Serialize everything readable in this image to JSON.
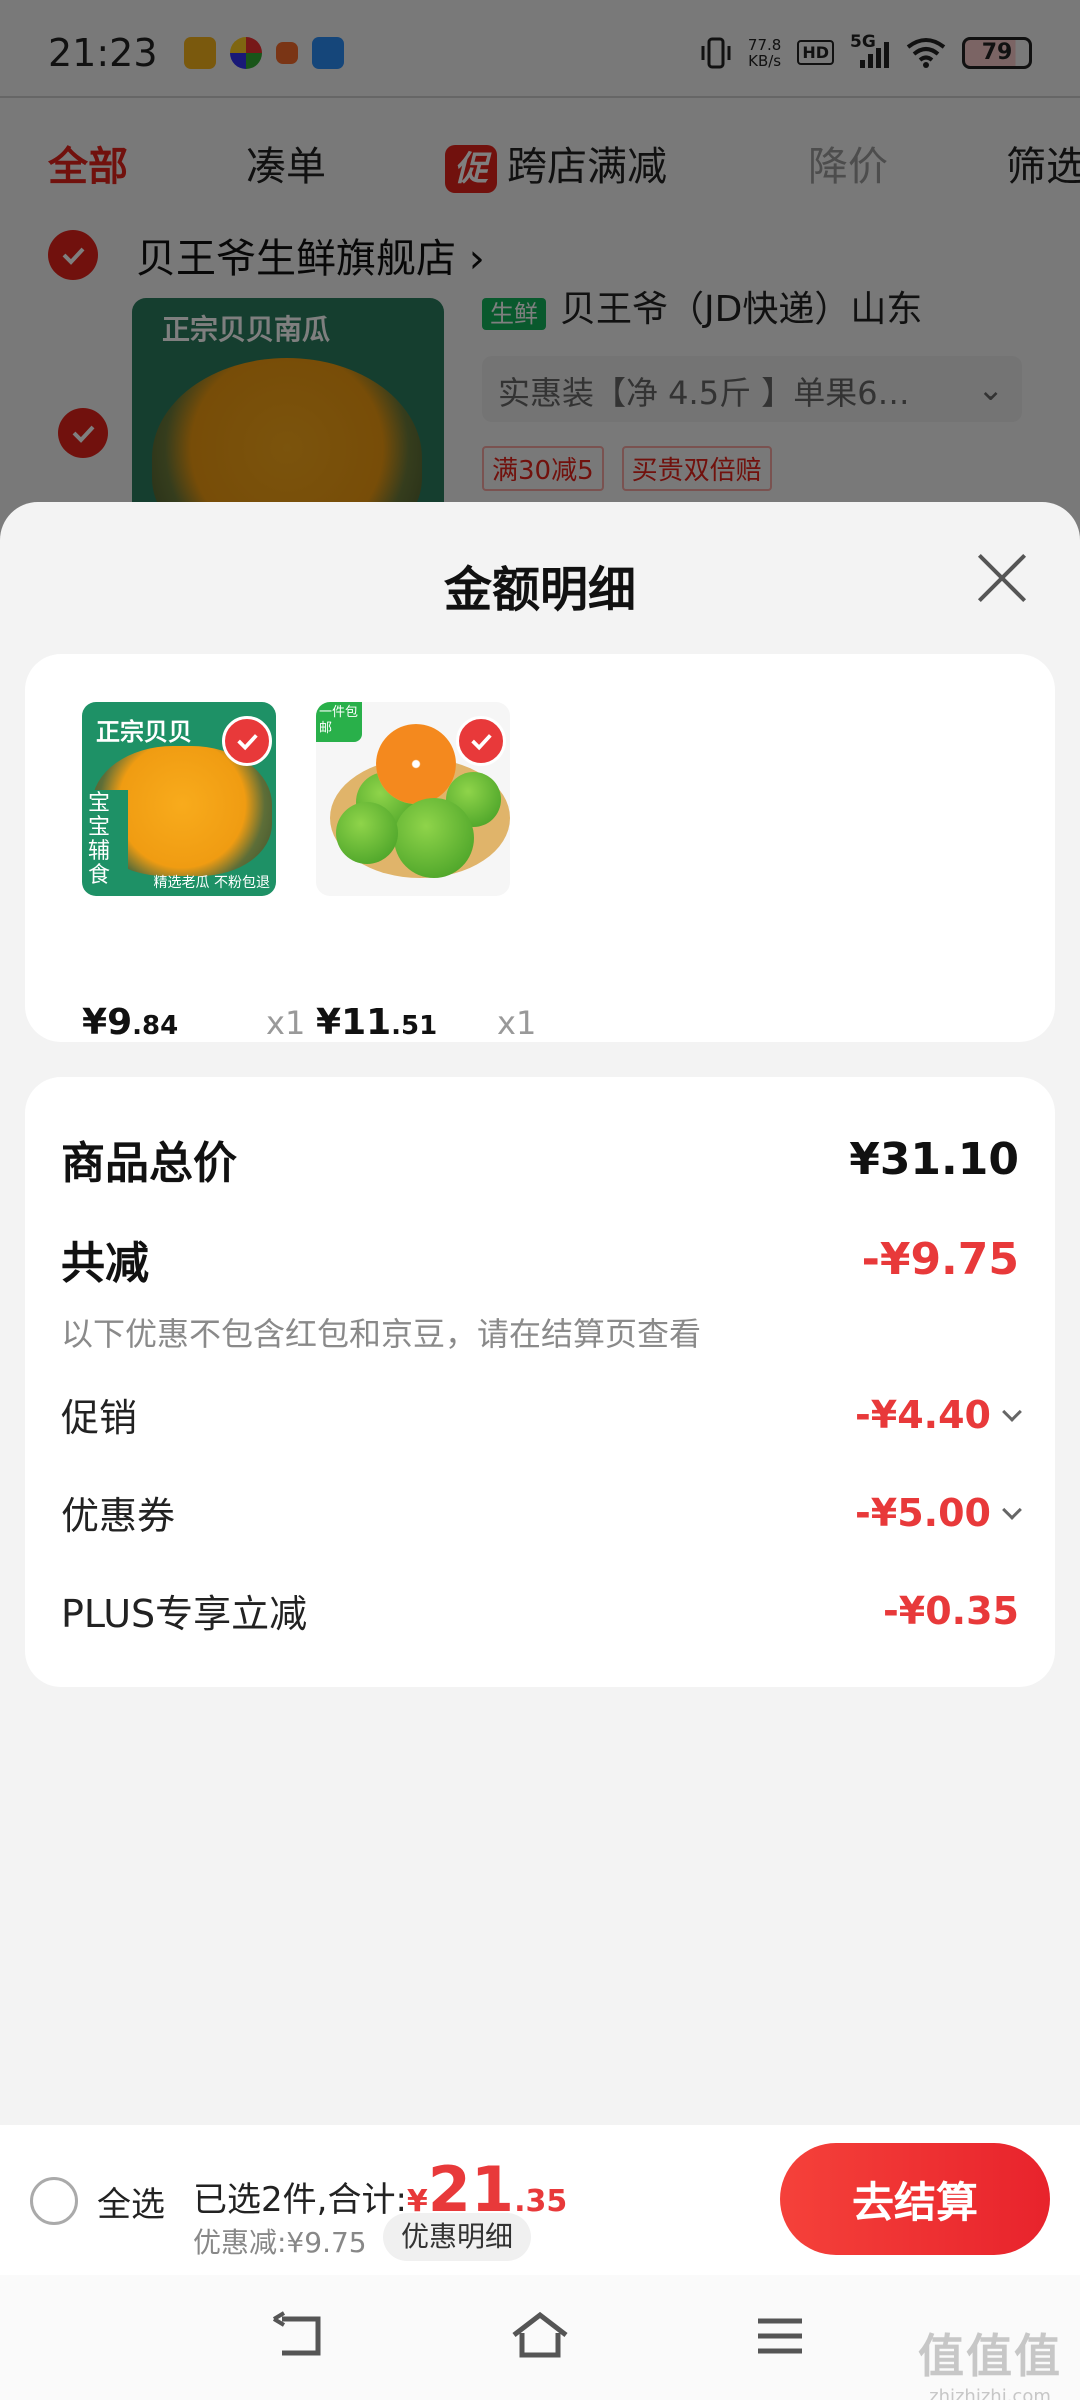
{
  "status_bar": {
    "time": "21:23",
    "net_speed_value": "77.8",
    "net_speed_unit": "KB/s",
    "hd_label": "HD",
    "signal_label": "5G",
    "battery": "79"
  },
  "filter_tabs": {
    "all": "全部",
    "bundle": "凑单",
    "promo_badge": "促",
    "cross_store": "跨店满减",
    "price_drop": "降价",
    "filter": "筛选"
  },
  "background_cart": {
    "store_name": "贝王爷生鲜旗舰店",
    "product_image_text": "正宗贝贝南瓜",
    "fresh_tag": "生鲜",
    "product_title": "贝王爷（JD快递）山东",
    "spec": "实惠装【净 4.5斤 】单果6…",
    "tags": [
      "满30减5",
      "买贵双倍赔"
    ]
  },
  "sheet": {
    "title": "金额明细",
    "items": [
      {
        "image_banner": "正宗贝贝",
        "image_side": "宝宝辅食",
        "image_bottom": "精选老瓜 不粉包退",
        "price_yen": "¥",
        "price_int": "9",
        "price_dec": ".84",
        "qty": "x1"
      },
      {
        "image_corner": "一件包邮",
        "price_yen": "¥",
        "price_int": "11",
        "price_dec": ".51",
        "qty": "x1"
      }
    ],
    "summary": {
      "total_label": "商品总价",
      "total_value": "¥31.10",
      "reduce_label": "共减",
      "reduce_value": "-¥9.75",
      "note": "以下优惠不包含红包和京豆，请在结算页查看",
      "promo_label": "促销",
      "promo_value": "-¥4.40",
      "coupon_label": "优惠券",
      "coupon_value": "-¥5.00",
      "plus_label": "PLUS专享立减",
      "plus_value": "-¥0.35"
    }
  },
  "checkout": {
    "select_all": "全选",
    "selected_prefix": "已选2件,合计:",
    "total_yen": "¥",
    "total_int": "21",
    "total_dec": ".35",
    "discount": "优惠减:¥9.75",
    "detail_button": "优惠明细",
    "checkout_button": "去结算"
  },
  "watermark": {
    "big": "值值值",
    "small": "zhizhizhi.com"
  },
  "colors": {
    "brand_red": "#e2231a",
    "price_red": "#e8393a",
    "sheet_bg": "#f3f3f3"
  }
}
